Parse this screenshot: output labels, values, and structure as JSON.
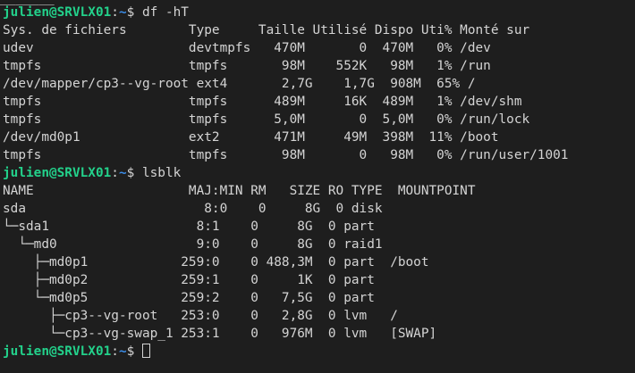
{
  "theme": {
    "background": "#1e1e1e",
    "text": "#d4d4d4",
    "prompt_user": "#23d18b",
    "prompt_path": "#3b8eea"
  },
  "top_partial": "_______",
  "lines": [
    {
      "kind": "prompt",
      "user": "julien@SRVLX01",
      "sep": ":",
      "path": "~",
      "symbol": "$ ",
      "command": "df -hT"
    },
    {
      "kind": "output",
      "text": "Sys. de fichiers        Type     Taille Utilisé Dispo Uti% Monté sur"
    },
    {
      "kind": "output",
      "text": "udev                    devtmpfs   470M       0  470M   0% /dev"
    },
    {
      "kind": "output",
      "text": "tmpfs                   tmpfs       98M    552K   98M   1% /run"
    },
    {
      "kind": "output",
      "text": "/dev/mapper/cp3--vg-root ext4       2,7G    1,7G  908M  65% /"
    },
    {
      "kind": "output",
      "text": "tmpfs                   tmpfs      489M     16K  489M   1% /dev/shm"
    },
    {
      "kind": "output",
      "text": "tmpfs                   tmpfs      5,0M       0  5,0M   0% /run/lock"
    },
    {
      "kind": "output",
      "text": "/dev/md0p1              ext2       471M     49M  398M  11% /boot"
    },
    {
      "kind": "output",
      "text": "tmpfs                   tmpfs       98M       0   98M   0% /run/user/1001"
    },
    {
      "kind": "prompt",
      "user": "julien@SRVLX01",
      "sep": ":",
      "path": "~",
      "symbol": "$ ",
      "command": "lsblk"
    },
    {
      "kind": "output",
      "text": "NAME                    MAJ:MIN RM   SIZE RO TYPE  MOUNTPOINT"
    },
    {
      "kind": "output",
      "text": "sda                       8:0    0     8G  0 disk"
    },
    {
      "kind": "output",
      "text": "└─sda1                   8:1    0     8G  0 part"
    },
    {
      "kind": "output",
      "text": "  └─md0                  9:0    0     8G  0 raid1"
    },
    {
      "kind": "output",
      "text": "    ├─md0p1            259:0    0 488,3M  0 part  /boot"
    },
    {
      "kind": "output",
      "text": "    ├─md0p2            259:1    0     1K  0 part"
    },
    {
      "kind": "output",
      "text": "    └─md0p5            259:2    0   7,5G  0 part"
    },
    {
      "kind": "output",
      "text": "      ├─cp3--vg-root   253:0    0   2,8G  0 lvm   /"
    },
    {
      "kind": "output",
      "text": "      └─cp3--vg-swap_1 253:1    0   976M  0 lvm   [SWAP]"
    },
    {
      "kind": "prompt",
      "user": "julien@SRVLX01",
      "sep": ":",
      "path": "~",
      "symbol": "$ ",
      "command": "",
      "cursor": true
    }
  ]
}
